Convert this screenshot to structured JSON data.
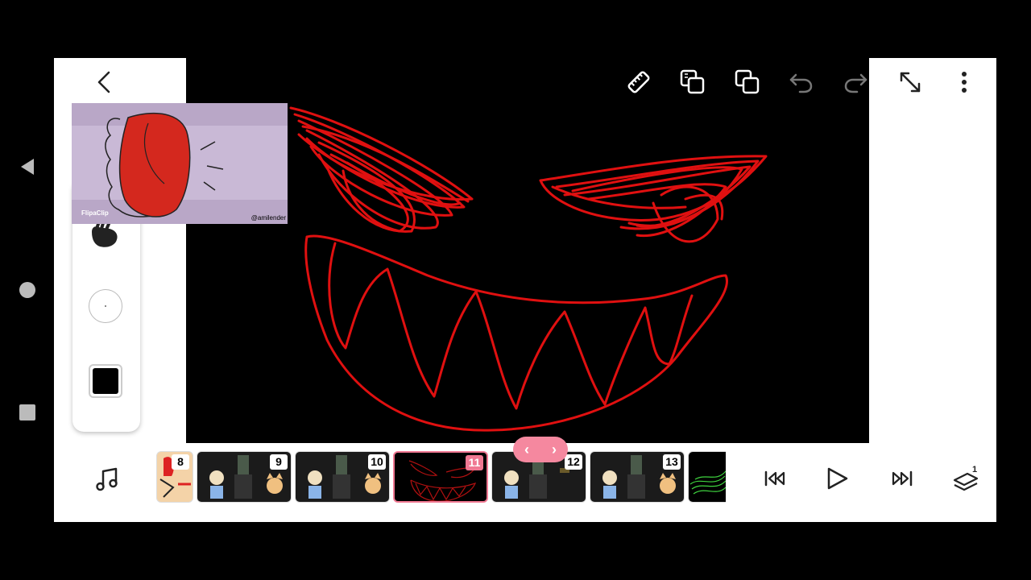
{
  "android_nav": {
    "back_icon": "triangle-back-icon",
    "home_icon": "circle-home-icon",
    "recents_icon": "square-recents-icon"
  },
  "toolbar": {
    "icons": [
      "back-chevron-icon",
      "ruler-icon",
      "layer-copy-icon",
      "layers-icon",
      "undo-icon",
      "redo-icon",
      "expand-icon",
      "more-vert-icon"
    ]
  },
  "overlay_clip": {
    "watermark_left": "FlipaClip",
    "watermark_right": "@amilender"
  },
  "tool_panel": {
    "brush_color": "#000000"
  },
  "timeline": {
    "frames": [
      {
        "number": "8",
        "active": false
      },
      {
        "number": "9",
        "active": false
      },
      {
        "number": "10",
        "active": false
      },
      {
        "number": "11",
        "active": true
      },
      {
        "number": "12",
        "active": false
      },
      {
        "number": "13",
        "active": false
      }
    ],
    "scroll_left": "‹",
    "scroll_right": "›",
    "onion_count": "1"
  },
  "colors": {
    "accent": "#f07892",
    "drawing_stroke": "#e01010",
    "canvas": "#000000"
  }
}
